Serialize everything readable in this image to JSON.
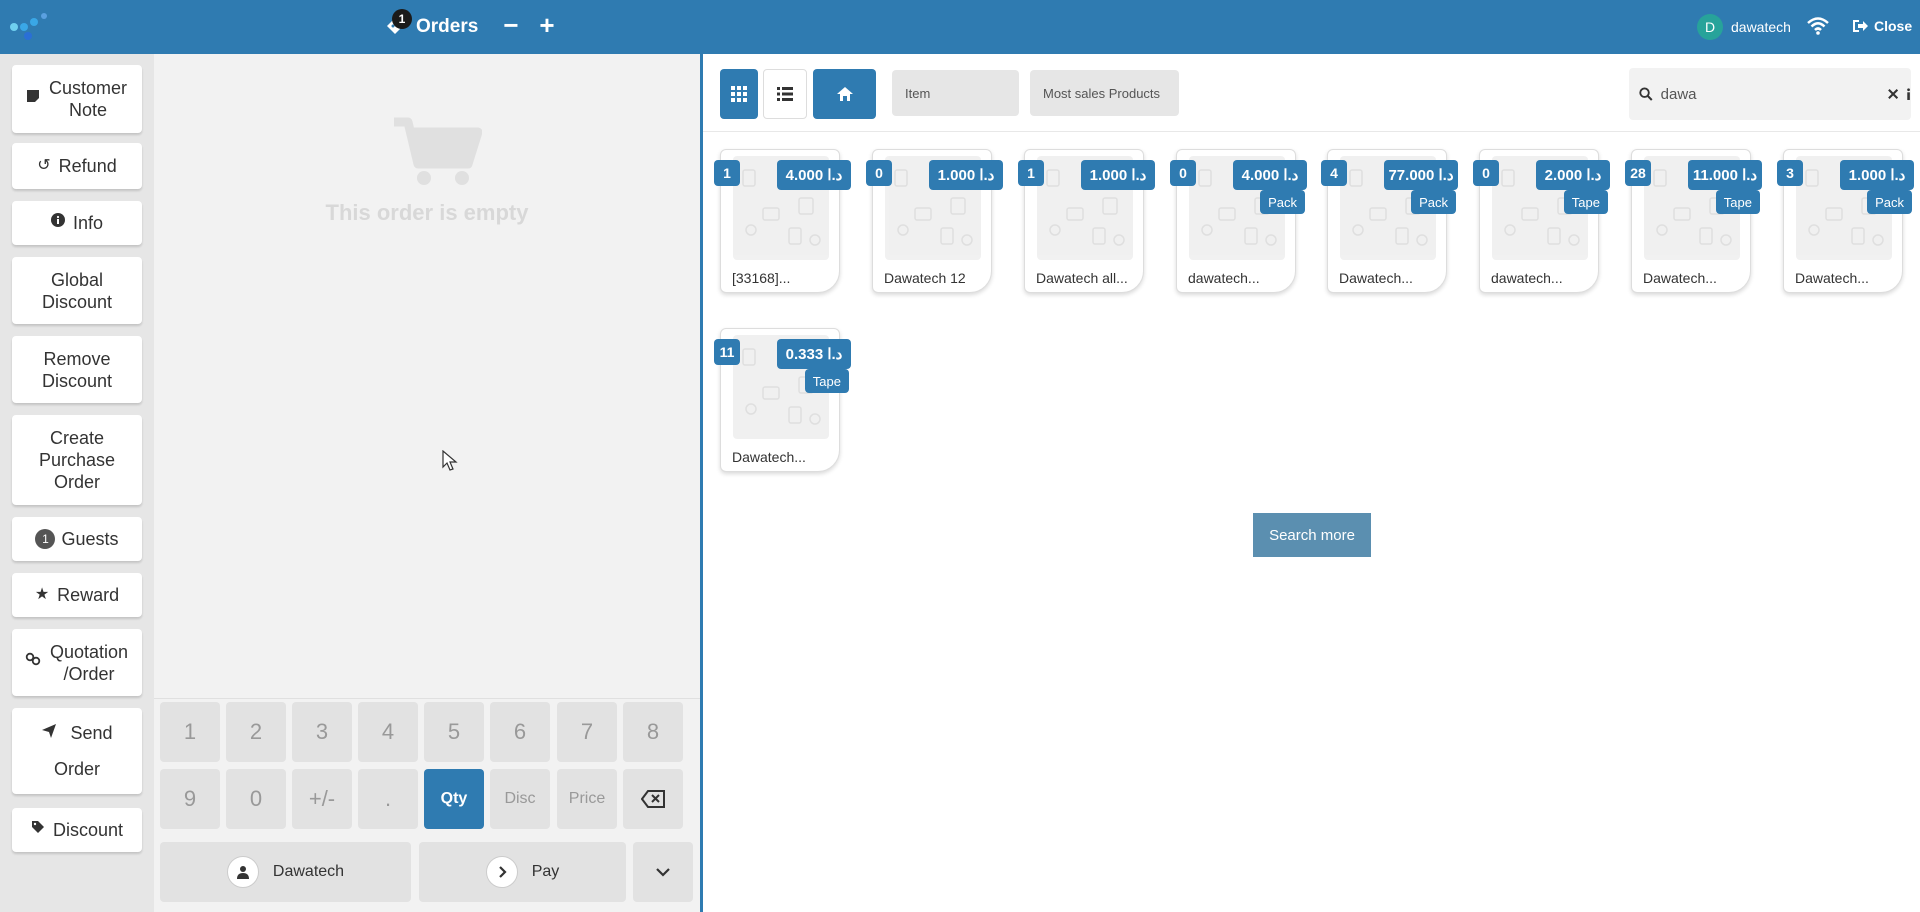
{
  "colors": {
    "primary": "#2f7bb1",
    "user_avatar": "#27a39a"
  },
  "topbar": {
    "orders_count": "1",
    "orders_label": "Orders",
    "minus_label": "−",
    "plus_label": "+",
    "user_initial": "D",
    "username": "dawatech",
    "close_label": "Close"
  },
  "controls": {
    "customer_note": "Customer Note",
    "refund": "Refund",
    "info": "Info",
    "global_discount": "Global Discount",
    "remove_discount": "Remove Discount",
    "create_po": "Create Purchase Order",
    "guests_count": "1",
    "guests": "Guests",
    "reward": "Reward",
    "quotation": "Quotation /Order",
    "send_order_line1": "Send",
    "send_order_line2": "Order",
    "discount": "Discount"
  },
  "order": {
    "empty_text": "This order is empty"
  },
  "numpad": {
    "keys": [
      "1",
      "2",
      "3",
      "4",
      "5",
      "6",
      "7",
      "8",
      "9",
      "0",
      "+/-",
      "."
    ],
    "qty": "Qty",
    "disc": "Disc",
    "price": "Price",
    "customer": "Dawatech",
    "pay": "Pay"
  },
  "products_toolbar": {
    "category_item": "Item",
    "category_most_sales": "Most sales Products",
    "search_value": "dawa"
  },
  "products": [
    {
      "qty": "1",
      "price": "4.000 د.ا",
      "unit": "",
      "name": "[33168]..."
    },
    {
      "qty": "0",
      "price": "1.000 د.ا",
      "unit": "",
      "name": "Dawatech 12"
    },
    {
      "qty": "1",
      "price": "1.000 د.ا",
      "unit": "",
      "name": "Dawatech all..."
    },
    {
      "qty": "0",
      "price": "4.000 د.ا",
      "unit": "Pack",
      "name": "dawatech..."
    },
    {
      "qty": "4",
      "price": "77.000 د.ا",
      "unit": "Pack",
      "name": "Dawatech..."
    },
    {
      "qty": "0",
      "price": "2.000 د.ا",
      "unit": "Tape",
      "name": "dawatech..."
    },
    {
      "qty": "28",
      "price": "11.000 د.ا",
      "unit": "Tape",
      "name": "Dawatech..."
    },
    {
      "qty": "3",
      "price": "1.000 د.ا",
      "unit": "Pack",
      "name": "Dawatech..."
    },
    {
      "qty": "11",
      "price": "0.333 د.ا",
      "unit": "Tape",
      "name": "Dawatech..."
    }
  ],
  "search_more": "Search more"
}
